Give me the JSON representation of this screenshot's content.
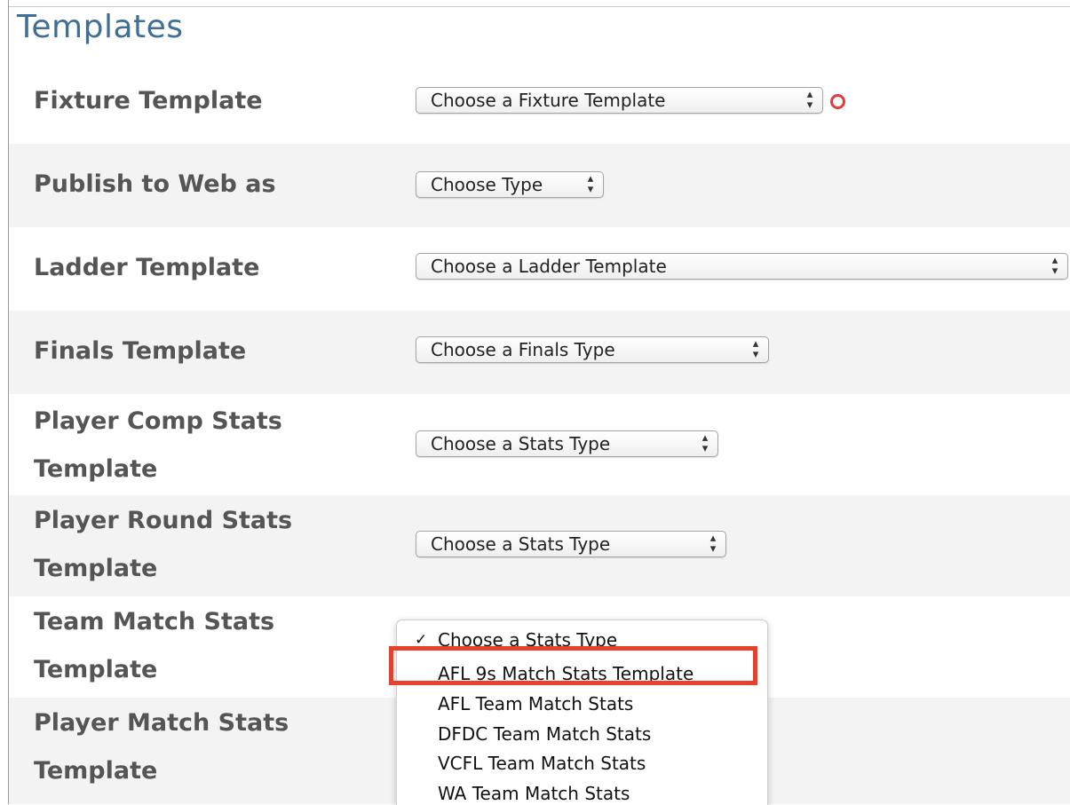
{
  "section": {
    "title": "Templates"
  },
  "rows": [
    {
      "label": "Fixture Template",
      "select": "Choose a Fixture Template",
      "required": true
    },
    {
      "label": "Publish to Web as",
      "select": "Choose Type"
    },
    {
      "label": "Ladder Template",
      "select": "Choose a Ladder Template"
    },
    {
      "label": "Finals Template",
      "select": "Choose a Finals Type"
    },
    {
      "label": "Player Comp Stats Template",
      "select": "Choose a Stats Type"
    },
    {
      "label": "Player Round Stats Template",
      "select": "Choose a Stats Type"
    },
    {
      "label": "Team Match Stats Template"
    },
    {
      "label": "Player Match Stats Template"
    }
  ],
  "dropdown": {
    "check_mark": "✓",
    "options": [
      "Choose a Stats Type",
      "AFL 9s Match Stats Template",
      "AFL Team Match Stats",
      "DFDC Team Match Stats",
      "VCFL Team Match Stats",
      "WA Team Match Stats"
    ],
    "selected_index": 0,
    "highlighted_index": 1
  },
  "colors": {
    "title": "#3f6f97",
    "label": "#555555",
    "row_alt": "#f3f3f3",
    "required": "#e23b3b",
    "highlight_box": "#e8412b"
  },
  "icons": {
    "select_arrows": "⇕",
    "required": "required-star-icon"
  }
}
